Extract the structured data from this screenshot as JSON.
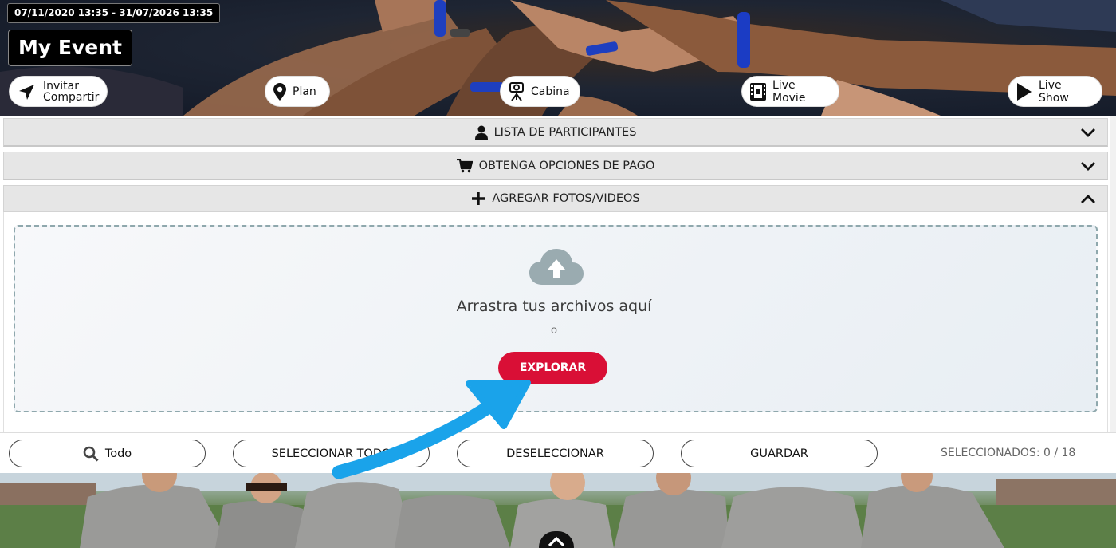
{
  "header": {
    "date_range": "07/11/2020 13:35 - 31/07/2026 13:35",
    "event_title": "My Event",
    "actions": [
      {
        "label_line1": "Invitar",
        "label_line2": "Compartir",
        "icon": "send-icon"
      },
      {
        "label": "Plan",
        "icon": "map-pin-icon"
      },
      {
        "label": "Cabina",
        "icon": "photo-booth-icon"
      },
      {
        "label": "Live Movie",
        "icon": "film-icon"
      },
      {
        "label": "Live Show",
        "icon": "play-icon"
      }
    ]
  },
  "accordion": {
    "participants_label": "LISTA DE PARTICIPANTES",
    "payment_label": "OBTENGA OPCIONES DE PAGO",
    "add_media_label": "AGREGAR FOTOS/VIDEOS"
  },
  "upload": {
    "drop_text": "Arrastra tus archivos aquí",
    "or_text": "o",
    "explore_label": "EXPLORAR"
  },
  "toolbar": {
    "filter_label": "Todo",
    "select_all_label": "SELECCIONAR TODO",
    "deselect_label": "DESELECCIONAR",
    "save_label": "GUARDAR",
    "selected_count": "SELECCIONADOS: 0 / 18"
  },
  "colors": {
    "accent_red": "#d90f36",
    "annotation_blue": "#1aa3ea",
    "accordion_bg": "#e6e6e6"
  }
}
